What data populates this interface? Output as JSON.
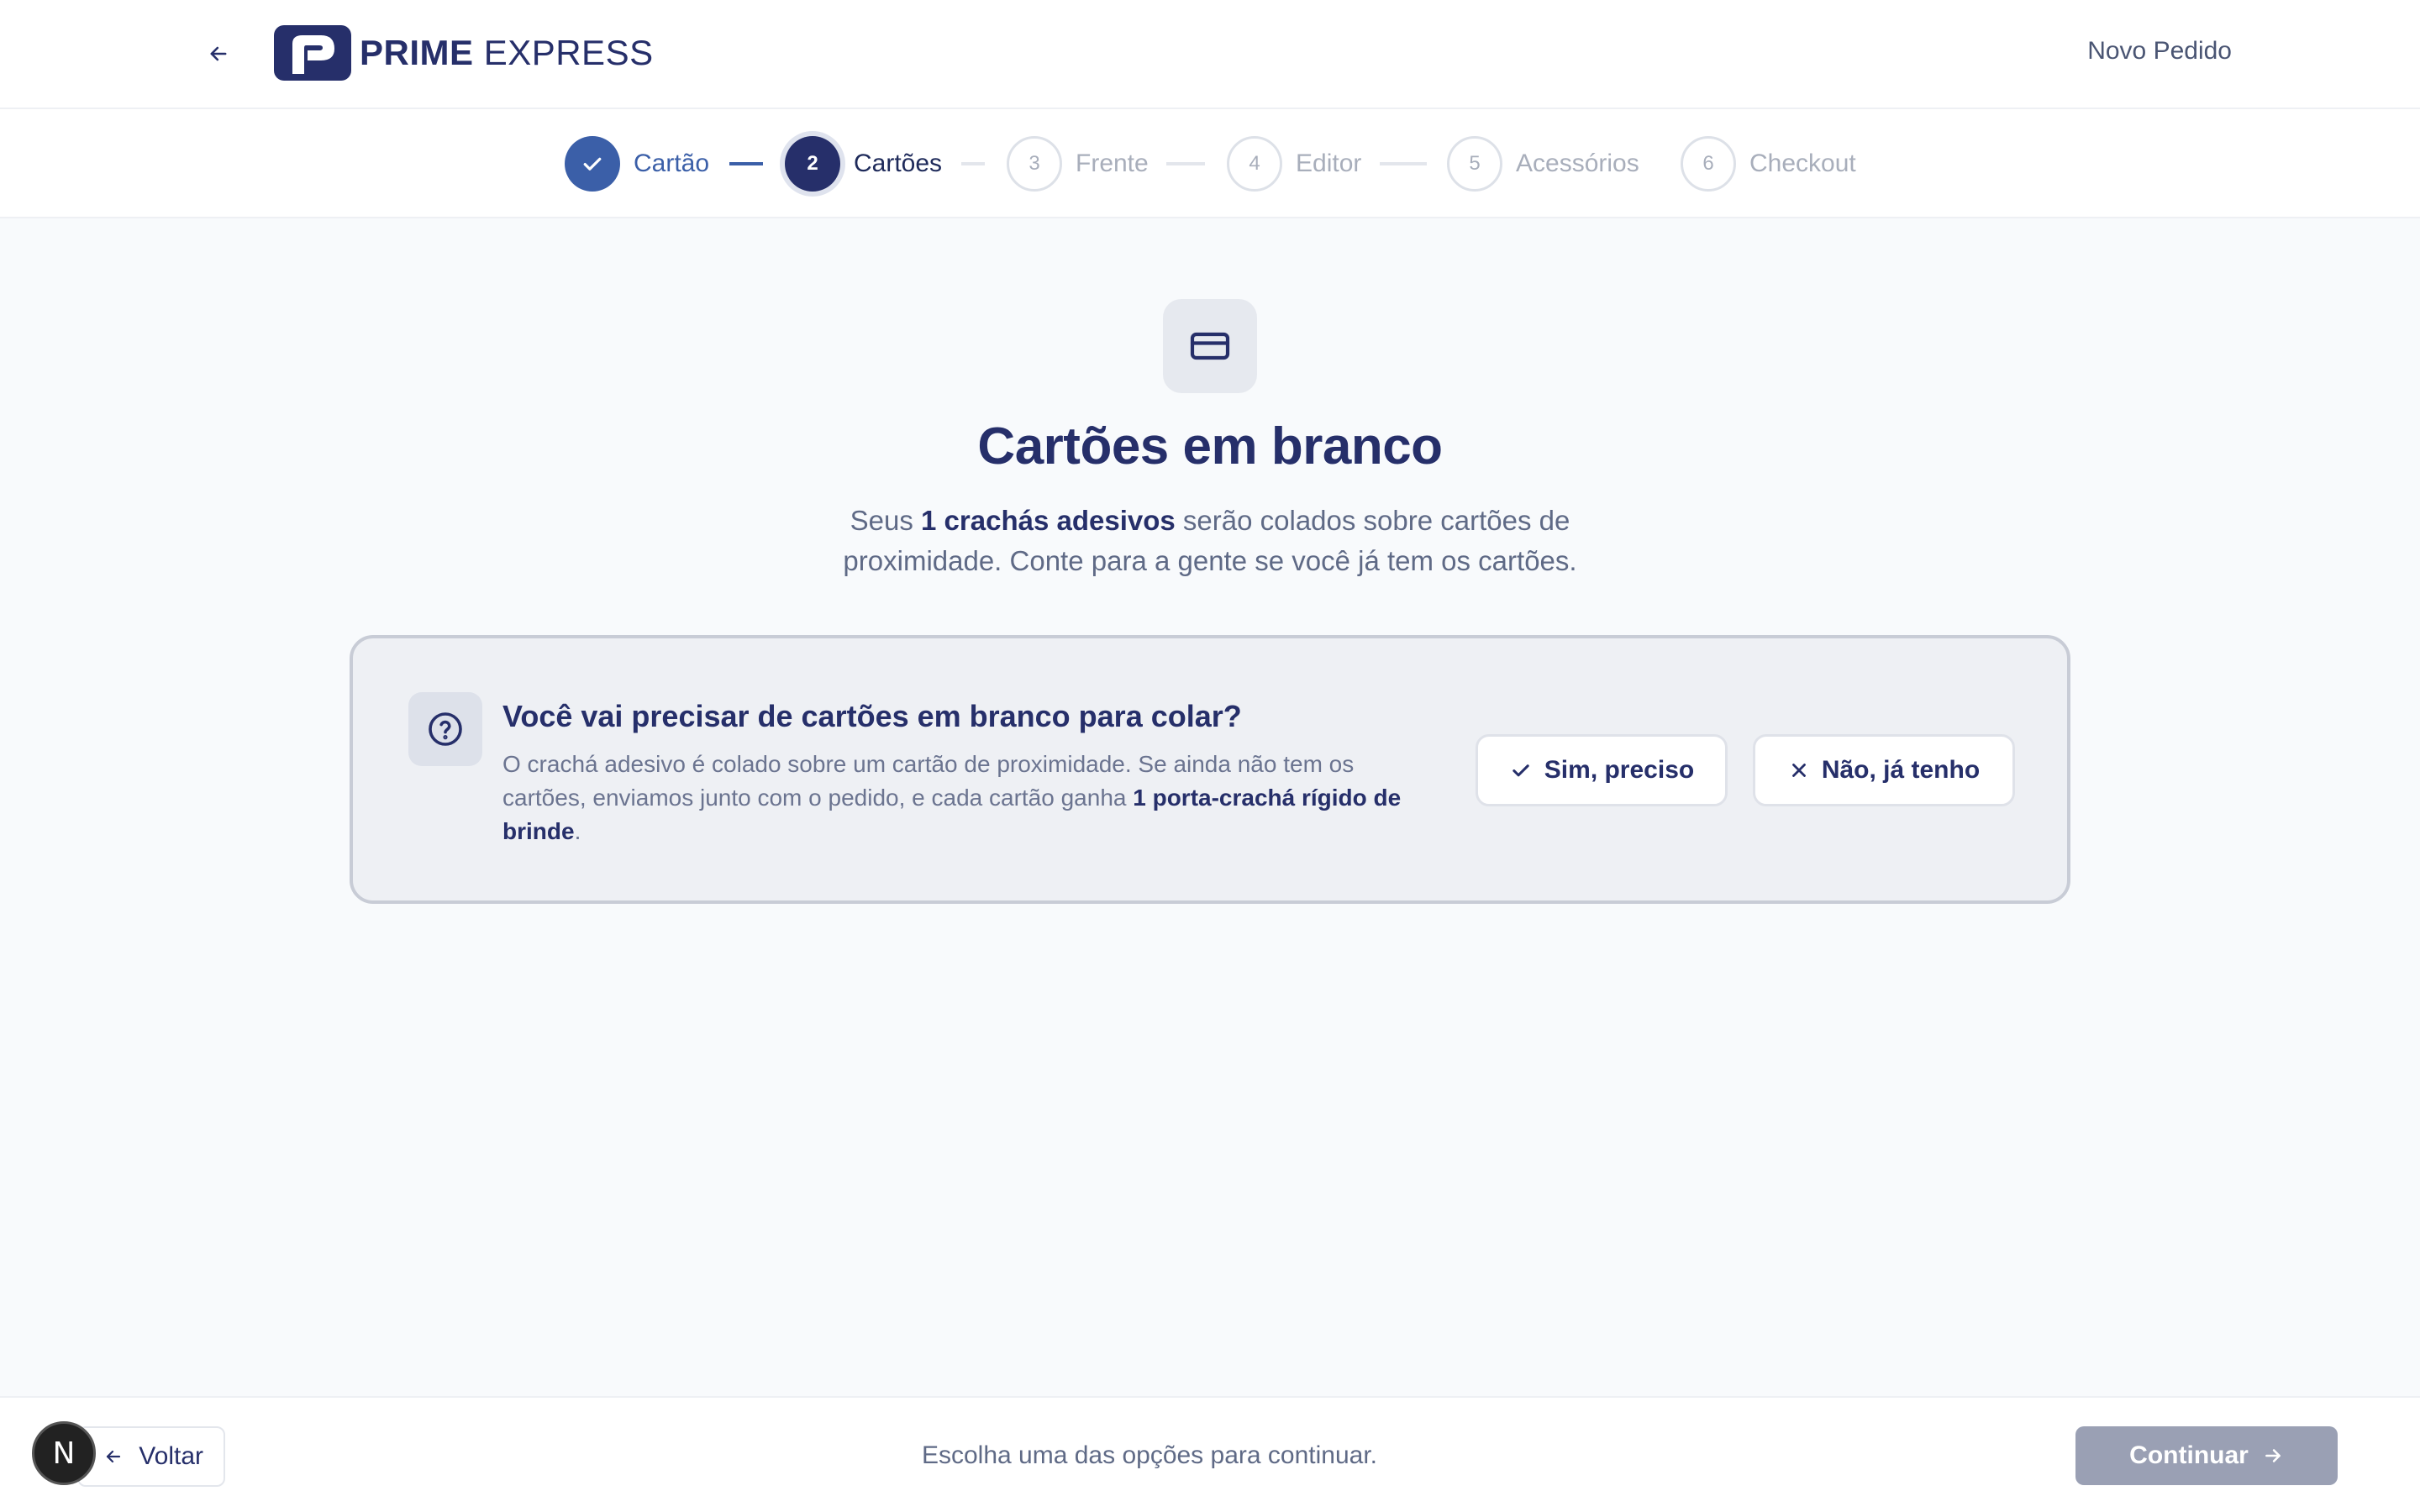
{
  "header": {
    "brand_bold": "PRIME",
    "brand_light": "EXPRESS",
    "right_link": "Novo Pedido"
  },
  "stepper": {
    "steps": [
      {
        "number": "",
        "label": "Cartão",
        "state": "done"
      },
      {
        "number": "2",
        "label": "Cartões",
        "state": "active"
      },
      {
        "number": "3",
        "label": "Frente",
        "state": "todo"
      },
      {
        "number": "4",
        "label": "Editor",
        "state": "todo"
      },
      {
        "number": "5",
        "label": "Acessórios",
        "state": "todo"
      },
      {
        "number": "6",
        "label": "Checkout",
        "state": "todo"
      }
    ]
  },
  "main": {
    "icon": "credit-card-icon",
    "title": "Cartões em branco",
    "subtitle_pre": "Seus ",
    "subtitle_bold": "1 crachás adesivos",
    "subtitle_post": " serão colados sobre cartões de proximidade. Conte para a gente se você já tem os cartões."
  },
  "question": {
    "icon": "help-circle-icon",
    "title": "Você vai precisar de cartões em branco para colar?",
    "desc_pre": "O crachá adesivo é colado sobre um cartão de proximidade. Se ainda não tem os cartões, enviamos junto com o pedido, e cada cartão ganha ",
    "desc_bold": "1 porta-crachá rígido de brinde",
    "desc_post": ".",
    "yes_label": "Sim, preciso",
    "no_label": "Não, já tenho"
  },
  "footer": {
    "back_label": "Voltar",
    "hint": "Escolha uma das opções para continuar.",
    "continue_label": "Continuar",
    "badge_letter": "N"
  },
  "colors": {
    "primary": "#262f6a",
    "done": "#3b5fa8",
    "disabled_button": "#9aa0b4"
  }
}
